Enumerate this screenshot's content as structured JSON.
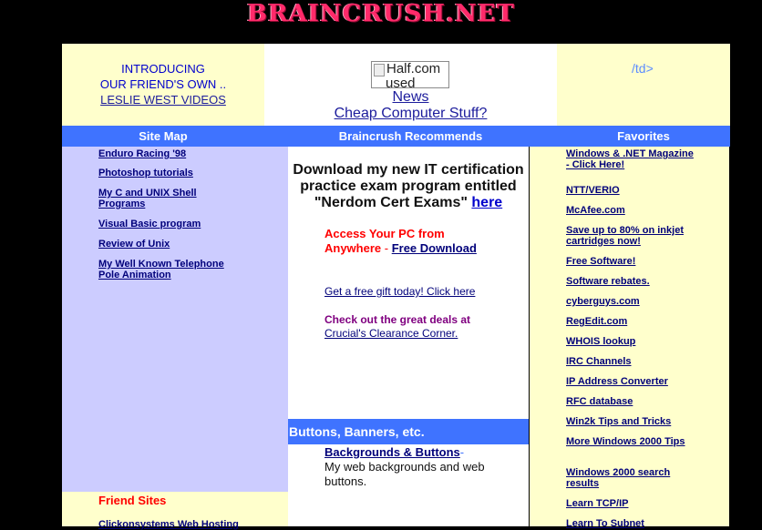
{
  "logo": {
    "text": "BRAINCRUSH.NET"
  },
  "top_left": {
    "line1": "INTRODUCING",
    "line2": "OUR FRIEND'S OWN ..",
    "link": "LESLIE WEST VIDEOS"
  },
  "top_mid": {
    "image_alt_line1": "Half.com",
    "image_alt_line2": "used",
    "news_link": "News",
    "computer_link": "Cheap Computer Stuff?"
  },
  "top_right": {
    "text": "/td>"
  },
  "headers": {
    "site_map": "Site Map",
    "recommends": "Braincrush Recommends",
    "favorites": "Favorites",
    "buttons": "Buttons, Banners, etc."
  },
  "site_map": {
    "items": [
      {
        "label": "Enduro Racing '98"
      },
      {
        "label": "Photoshop tutorials"
      },
      {
        "label": "My C and UNIX Shell Programs"
      },
      {
        "label": "Visual Basic program"
      },
      {
        "label": "Review of Unix"
      },
      {
        "label": "My Well Known Telephone Pole Animation"
      }
    ]
  },
  "friend_sites": {
    "title": "Friend Sites",
    "first_item": "Clickonsystems Web Hosting"
  },
  "recommends": {
    "cert_text": "Download my new IT certification practice exam program entitled \"Nerdom Cert Exams\"",
    "cert_link": "here",
    "access_text": "Access Your PC from Anywhere",
    "access_sep": " - ",
    "free_download": "Free Download",
    "gift_link": "Get a free gift today! Click here",
    "crucial_text": "Check out the great deals at",
    "crucial_link": "Crucial's Clearance Corner.",
    "backgrounds_link": "Backgrounds & Buttons",
    "backgrounds_dash": "-",
    "backgrounds_desc": "My web backgrounds and web buttons."
  },
  "favorites": {
    "items": [
      {
        "label": "Windows & .NET Magazine - Click Here!"
      },
      {
        "label": "NTT/VERIO"
      },
      {
        "label": "McAfee.com"
      },
      {
        "label": "Save up to 80% on inkjet cartridges now!"
      },
      {
        "label": "Free Software!"
      },
      {
        "label": "Software rebates."
      },
      {
        "label": "cyberguys.com"
      },
      {
        "label": "RegEdit.com"
      },
      {
        "label": "WHOIS lookup"
      },
      {
        "label": "IRC Channels"
      },
      {
        "label": "IP Address Converter"
      },
      {
        "label": "RFC database"
      },
      {
        "label": "Win2k Tips and Tricks"
      },
      {
        "label": "More Windows 2000 Tips"
      },
      {
        "label": "Windows 2000 search results"
      },
      {
        "label": "Learn TCP/IP"
      },
      {
        "label": "Learn To Subnet"
      }
    ]
  },
  "colors": {
    "page_bg": "#000000",
    "header_blue": "#3f73ff",
    "cream": "#ffffcc",
    "lavender": "#ccccff",
    "link_navy": "#00007a",
    "red": "#ff0000",
    "purple": "#800080"
  }
}
